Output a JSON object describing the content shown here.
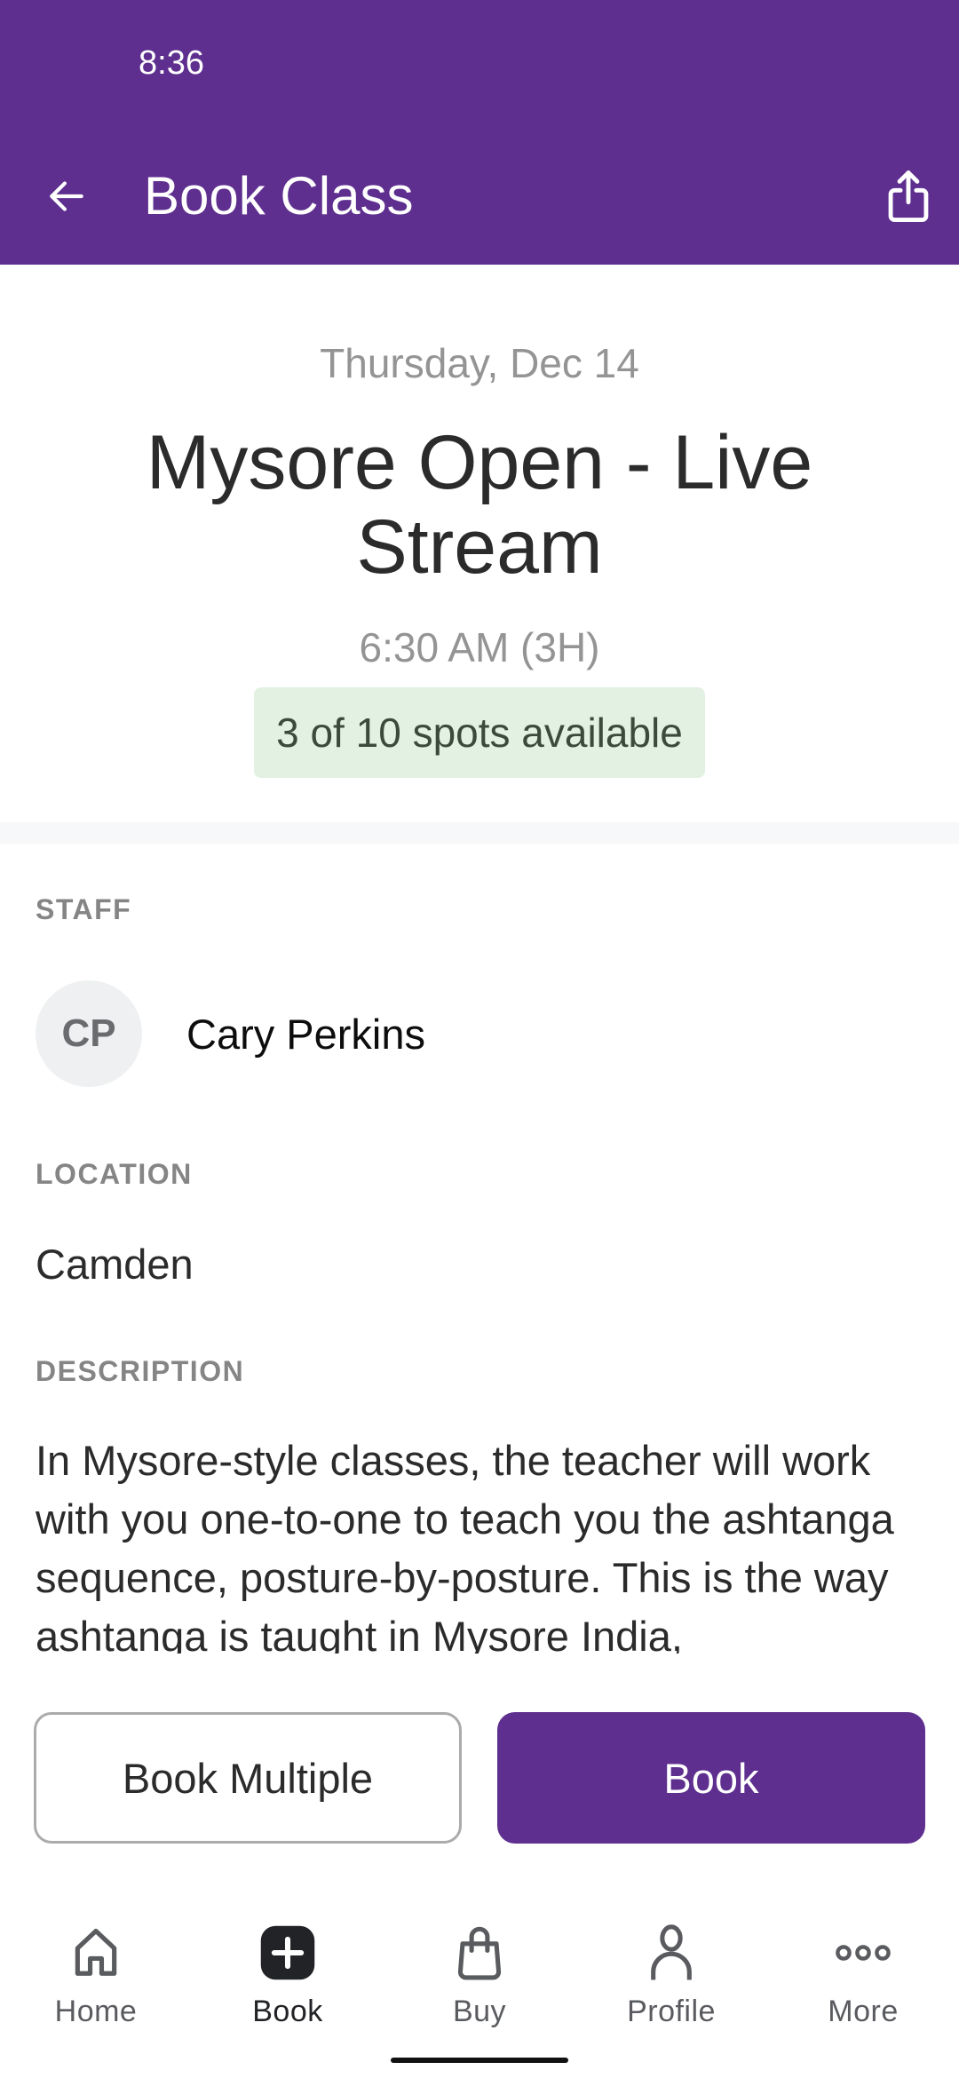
{
  "status_bar": {
    "time": "8:36"
  },
  "header": {
    "title": "Book Class",
    "back_icon": "arrow-left-icon",
    "share_icon": "share-icon"
  },
  "class": {
    "date": "Thursday, Dec 14",
    "name": "Mysore Open - Live Stream",
    "time": "6:30 AM (3H)",
    "availability": "3 of 10 spots available",
    "spots_available": 3,
    "spots_total": 10
  },
  "staff": {
    "label": "STAFF",
    "initials": "CP",
    "name": "Cary Perkins"
  },
  "location": {
    "label": "LOCATION",
    "value": "Camden"
  },
  "description": {
    "label": "DESCRIPTION",
    "text": "In Mysore-style classes, the teacher will work with you one-to-one to teach you the ashtanga sequence, posture-by-posture. This is the way ashtanga is taught in Mysore India,"
  },
  "actions": {
    "book_multiple_label": "Book Multiple",
    "book_label": "Book"
  },
  "nav": {
    "items": [
      {
        "label": "Home",
        "icon": "home-icon",
        "active": false
      },
      {
        "label": "Book",
        "icon": "plus-square-icon",
        "active": true
      },
      {
        "label": "Buy",
        "icon": "shopping-bag-icon",
        "active": false
      },
      {
        "label": "Profile",
        "icon": "person-icon",
        "active": false
      },
      {
        "label": "More",
        "icon": "more-dots-icon",
        "active": false
      }
    ]
  },
  "colors": {
    "brand": "#5e2f8f",
    "badge_bg": "#e3f1e2",
    "muted_text": "#949494",
    "label_text": "#858585"
  }
}
